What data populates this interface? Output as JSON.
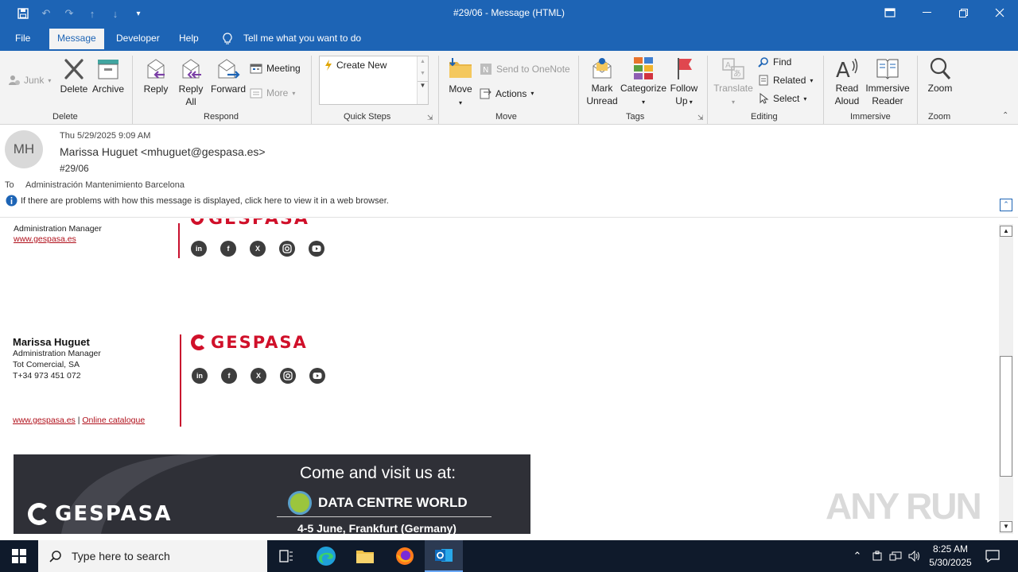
{
  "window": {
    "title": "#29/06  -  Message (HTML)"
  },
  "tabs": [
    {
      "label": "File"
    },
    {
      "label": "Message"
    },
    {
      "label": "Developer"
    },
    {
      "label": "Help"
    }
  ],
  "tell_me": "Tell me what you want to do",
  "ribbon": {
    "junk": "Junk",
    "delete": "Delete",
    "archive": "Archive",
    "reply": "Reply",
    "reply_all_1": "Reply",
    "reply_all_2": "All",
    "forward": "Forward",
    "meeting": "Meeting",
    "more": "More",
    "quick_steps_item": "Create New",
    "move": "Move",
    "send_onenote": "Send to OneNote",
    "actions": "Actions",
    "mark_unread_1": "Mark",
    "mark_unread_2": "Unread",
    "categorize": "Categorize",
    "follow_up_1": "Follow",
    "follow_up_2": "Up",
    "translate": "Translate",
    "find": "Find",
    "related": "Related",
    "select": "Select",
    "read_aloud_1": "Read",
    "read_aloud_2": "Aloud",
    "immersive_1": "Immersive",
    "immersive_2": "Reader",
    "zoom": "Zoom",
    "groups": {
      "delete": "Delete",
      "respond": "Respond",
      "quick_steps": "Quick Steps",
      "move": "Move",
      "tags": "Tags",
      "editing": "Editing",
      "immersive": "Immersive",
      "zoom": "Zoom"
    }
  },
  "message": {
    "avatar_initials": "MH",
    "date": "Thu 5/29/2025 9:09 AM",
    "from": "Marissa Huguet <mhuguet@gespasa.es>",
    "subject": "#29/06",
    "to_label": "To",
    "to": "Administración Mantenimiento Barcelona",
    "info_bar": "If there are problems with how this message is displayed, click here to view it in a web browser."
  },
  "body": {
    "sig1_title": "Administration Manager",
    "sig1_link": "www.gespasa.es",
    "sig2_name": "Marissa Huguet",
    "sig2_title": "Administration Manager",
    "sig2_company": "Tot Comercial, SA",
    "sig2_phone": "T+34 973 451 072",
    "sig2_link1": "www.gespasa.es",
    "sig2_sep": "|",
    "sig2_link2": "Online catalogue",
    "brand": "GESPASA",
    "banner_heading": "Come and visit us at:",
    "banner_event": "DATA CENTRE WORLD",
    "banner_date": "4-5 June, Frankfurt (Germany)"
  },
  "taskbar": {
    "search_placeholder": "Type here to search",
    "time": "8:25 AM",
    "date": "5/30/2025"
  },
  "watermark": "ANY RUN"
}
